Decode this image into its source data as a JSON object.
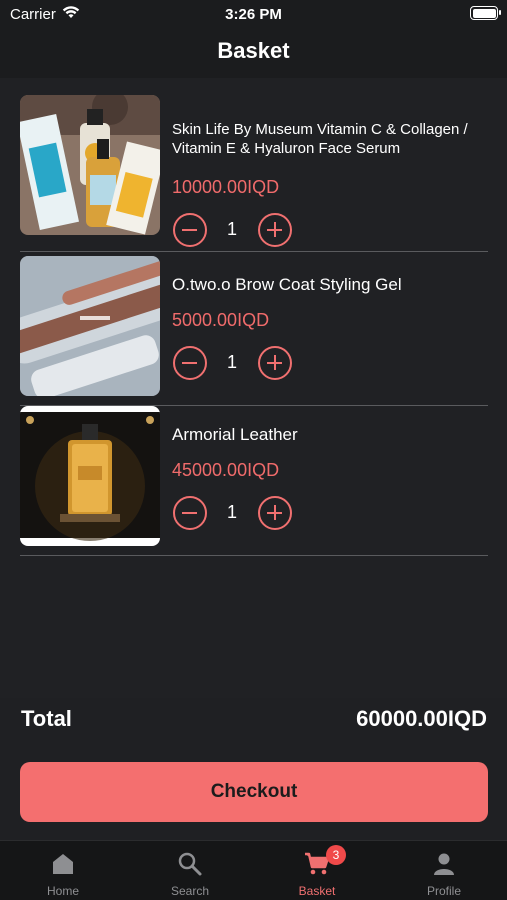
{
  "status_bar": {
    "carrier": "Carrier",
    "time": "3:26 PM"
  },
  "header": {
    "title": "Basket"
  },
  "items": [
    {
      "name": "Skin Life By Museum Vitamin C & Collagen / Vitamin E & Hyaluron Face Serum",
      "price": "10000.00IQD",
      "quantity": "1"
    },
    {
      "name": "O.two.o Brow Coat Styling Gel",
      "price": "5000.00IQD",
      "quantity": "1"
    },
    {
      "name": "Armorial Leather",
      "price": "45000.00IQD",
      "quantity": "1"
    }
  ],
  "total": {
    "label": "Total",
    "value": "60000.00IQD"
  },
  "checkout": {
    "label": "Checkout"
  },
  "tabs": [
    {
      "label": "Home",
      "icon": "home-icon"
    },
    {
      "label": "Search",
      "icon": "search-icon"
    },
    {
      "label": "Basket",
      "icon": "cart-icon",
      "badge": "3",
      "active": true
    },
    {
      "label": "Profile",
      "icon": "person-icon"
    }
  ],
  "colors": {
    "accent": "#f46f6f",
    "background": "#1f2023",
    "price": "#f06b6b",
    "badge": "#f04a4a"
  }
}
